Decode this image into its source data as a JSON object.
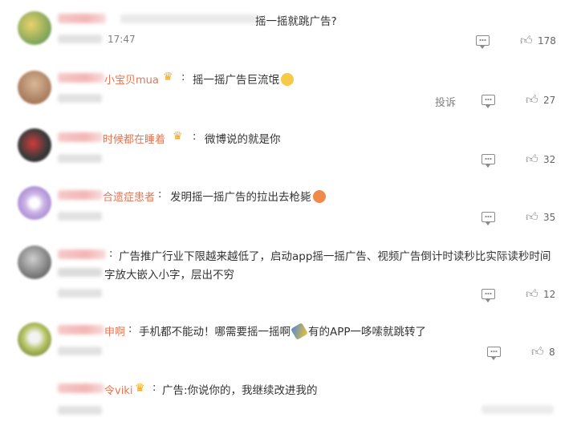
{
  "comments": [
    {
      "id": 1,
      "name_suffix": "",
      "text": "摇一摇就跳广告?",
      "time": "17:47",
      "likes": "178",
      "avatar_color": "#c9b24a"
    },
    {
      "id": 2,
      "name_suffix": "小宝贝mua",
      "text": "摇一摇广告巨流氓",
      "report": "投诉",
      "likes": "27",
      "avatar_color": "#b7906e"
    },
    {
      "id": 3,
      "name_suffix": "时候都在睡着",
      "text": "微博说的就是你",
      "likes": "32",
      "avatar_color": "#3b3b3b"
    },
    {
      "id": 4,
      "name_suffix": "合遗症患者",
      "text": "发明摇一摇广告的拉出去枪毙",
      "likes": "35",
      "avatar_color": "#c9b3e3"
    },
    {
      "id": 5,
      "name_suffix": "",
      "text_line1": "广告推广行业下限越来越低了，启动app摇一摇广告、视频广告倒计时读秒比实际读秒时间",
      "text_line2": "字放大嵌入小字，层出不穷",
      "likes": "12",
      "avatar_color": "#8d8d8d"
    },
    {
      "id": 6,
      "name_suffix": "申啊",
      "text_a": "手机都不能动！哪需要摇一摇啊",
      "text_b": "有的APP一哆嗦就跳转了",
      "likes": "8",
      "avatar_color": "#a9b85a"
    },
    {
      "id": 7,
      "name_suffix": "令viki",
      "text": "广告:你说你的，我继续改进我的",
      "avatar_color": "#ffffff"
    }
  ],
  "icons": {
    "reply": "comment-icon",
    "like": "thumbs-up-icon",
    "crown": "crown-badge-icon"
  },
  "colors": {
    "name": "#eb7350",
    "text": "#333333",
    "meta": "#808080"
  }
}
